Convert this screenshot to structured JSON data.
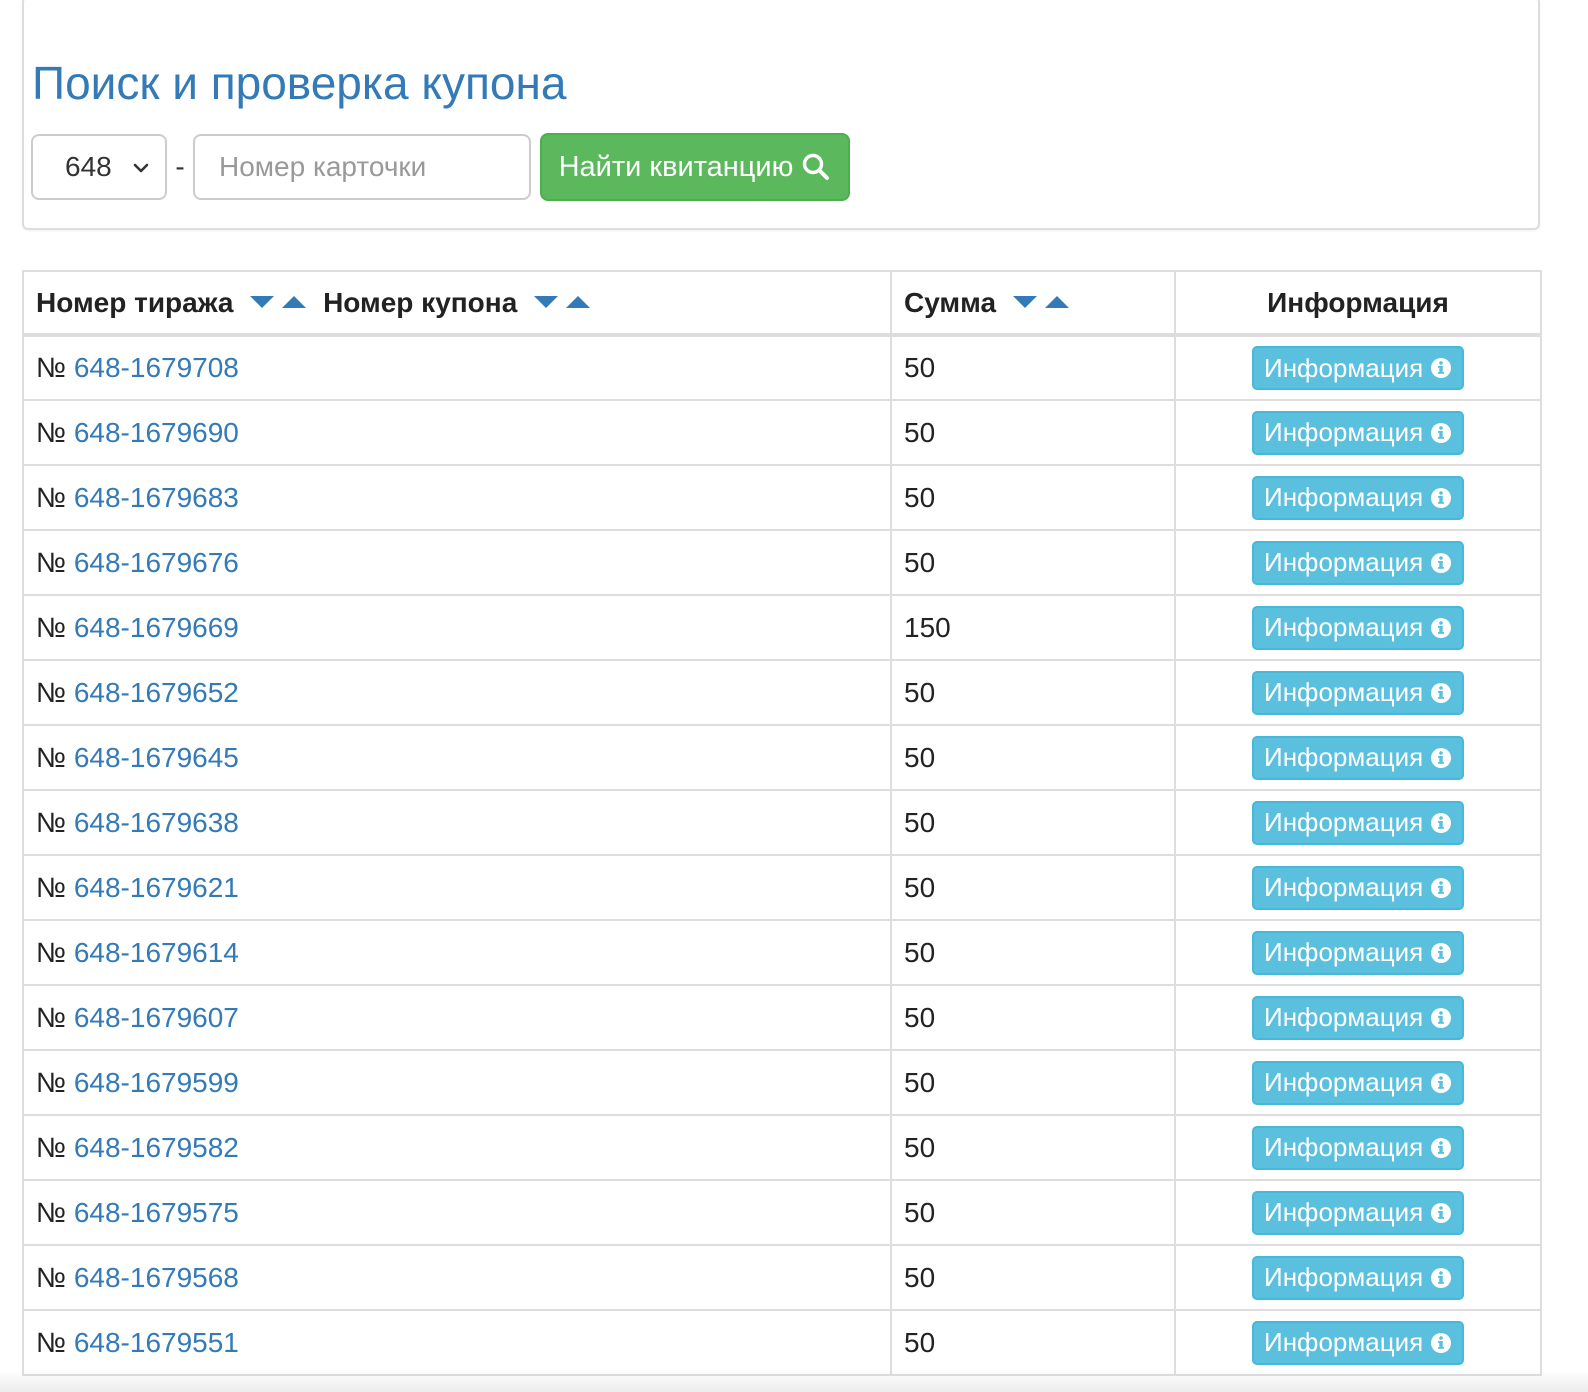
{
  "title": "Поиск и проверка купона",
  "search": {
    "series_value": "648",
    "dash": "-",
    "card_placeholder": "Номер карточки",
    "button_label": "Найти квитанцию"
  },
  "table": {
    "headers": {
      "draw": "Номер тиража",
      "coupon": "Номер купона",
      "amount": "Сумма",
      "info": "Информация"
    },
    "number_prefix": "№",
    "info_button_label": "Информация",
    "rows": [
      {
        "coupon": "648-1679708",
        "amount": "50"
      },
      {
        "coupon": "648-1679690",
        "amount": "50"
      },
      {
        "coupon": "648-1679683",
        "amount": "50"
      },
      {
        "coupon": "648-1679676",
        "amount": "50"
      },
      {
        "coupon": "648-1679669",
        "amount": "150"
      },
      {
        "coupon": "648-1679652",
        "amount": "50"
      },
      {
        "coupon": "648-1679645",
        "amount": "50"
      },
      {
        "coupon": "648-1679638",
        "amount": "50"
      },
      {
        "coupon": "648-1679621",
        "amount": "50"
      },
      {
        "coupon": "648-1679614",
        "amount": "50"
      },
      {
        "coupon": "648-1679607",
        "amount": "50"
      },
      {
        "coupon": "648-1679599",
        "amount": "50"
      },
      {
        "coupon": "648-1679582",
        "amount": "50"
      },
      {
        "coupon": "648-1679575",
        "amount": "50"
      },
      {
        "coupon": "648-1679568",
        "amount": "50"
      },
      {
        "coupon": "648-1679551",
        "amount": "50"
      }
    ]
  },
  "colors": {
    "link": "#337ab7",
    "success": "#5cb85c",
    "info": "#5bc0de",
    "border": "#dddddd"
  },
  "icons": {
    "select": "chevron-down-icon",
    "search": "search-icon",
    "sort_desc": "sort-desc-icon",
    "sort_asc": "sort-asc-icon",
    "info": "info-circle-icon"
  }
}
